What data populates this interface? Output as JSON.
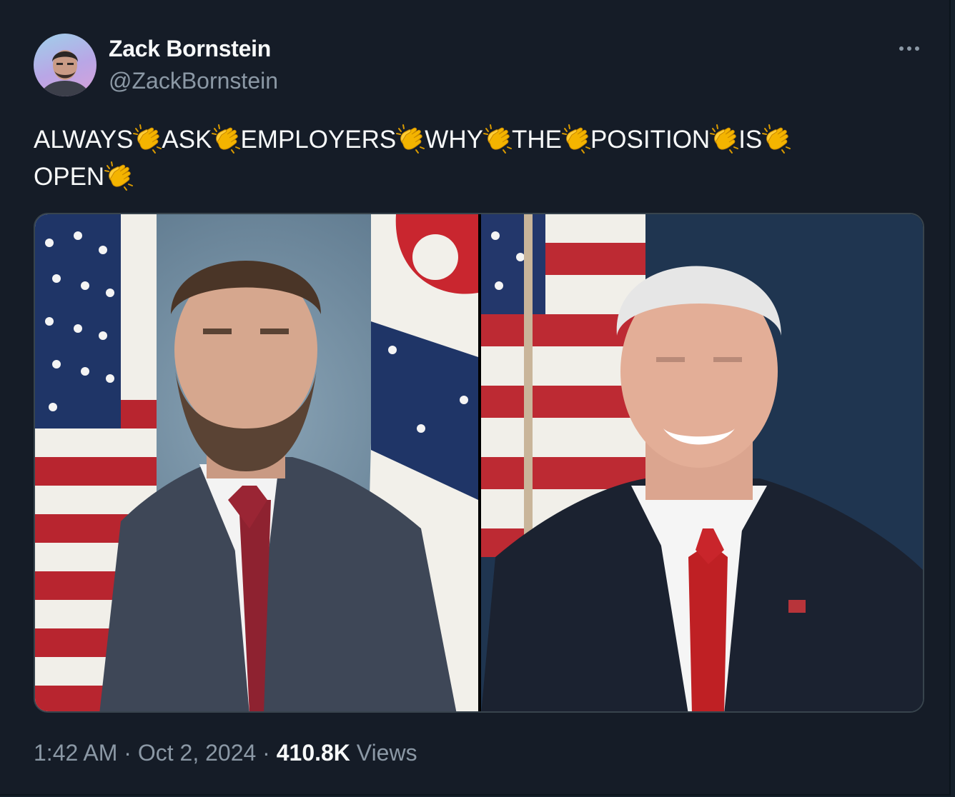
{
  "author": {
    "display_name": "Zack Bornstein",
    "handle": "@ZackBornstein"
  },
  "more_menu_icon": "ellipsis-icon",
  "tweet": {
    "words": [
      "ALWAYS",
      "ASK",
      "EMPLOYERS",
      "WHY",
      "THE",
      "POSITION",
      "IS",
      "OPEN"
    ],
    "separator_icon": "clapping-hands-emoji"
  },
  "media": {
    "photos": [
      {
        "name": "left-portrait"
      },
      {
        "name": "right-portrait"
      }
    ]
  },
  "meta": {
    "time": "1:42 AM",
    "dot1": " · ",
    "date": "Oct 2, 2024",
    "dot2": " · ",
    "views_count": "410.8K",
    "views_label": " Views"
  },
  "colors": {
    "background": "#151c27",
    "text_primary": "#f7f9f9",
    "text_secondary": "#8b98a5",
    "border": "#38444d"
  }
}
